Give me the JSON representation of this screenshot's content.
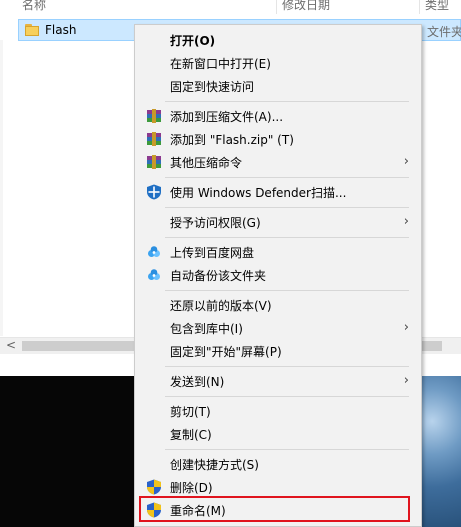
{
  "explorer": {
    "columns": {
      "name": "名称",
      "date": "修改日期",
      "type": "类型"
    },
    "file": {
      "name": "Flash",
      "type": "文件夹"
    },
    "scroll_left": "<"
  },
  "context_menu": {
    "items": [
      {
        "label": "打开(O)",
        "bold": true
      },
      {
        "label": "在新窗口中打开(E)"
      },
      {
        "label": "固定到快速访问"
      },
      {
        "label": "添加到压缩文件(A)...",
        "icon": "archive-icon"
      },
      {
        "label": "添加到 \"Flash.zip\" (T)",
        "icon": "archive-icon"
      },
      {
        "label": "其他压缩命令",
        "icon": "archive-icon",
        "submenu": true
      },
      {
        "label": "使用 Windows Defender扫描...",
        "icon": "defender-shield-icon"
      },
      {
        "label": "授予访问权限(G)",
        "submenu": true
      },
      {
        "label": "上传到百度网盘",
        "icon": "baidu-cloud-icon"
      },
      {
        "label": "自动备份该文件夹",
        "icon": "baidu-cloud-icon"
      },
      {
        "label": "还原以前的版本(V)"
      },
      {
        "label": "包含到库中(I)",
        "submenu": true
      },
      {
        "label": "固定到\"开始\"屏幕(P)"
      },
      {
        "label": "发送到(N)",
        "submenu": true
      },
      {
        "label": "剪切(T)"
      },
      {
        "label": "复制(C)"
      },
      {
        "label": "创建快捷方式(S)"
      },
      {
        "label": "删除(D)",
        "icon": "uac-shield-icon"
      },
      {
        "label": "重命名(M)",
        "icon": "uac-shield-icon",
        "highlighted": true
      }
    ],
    "submenu_arrow": "›"
  },
  "colors": {
    "selection_bg": "#cce8ff",
    "menu_bg": "#f2f2f2",
    "highlight_border": "#e0141e"
  }
}
